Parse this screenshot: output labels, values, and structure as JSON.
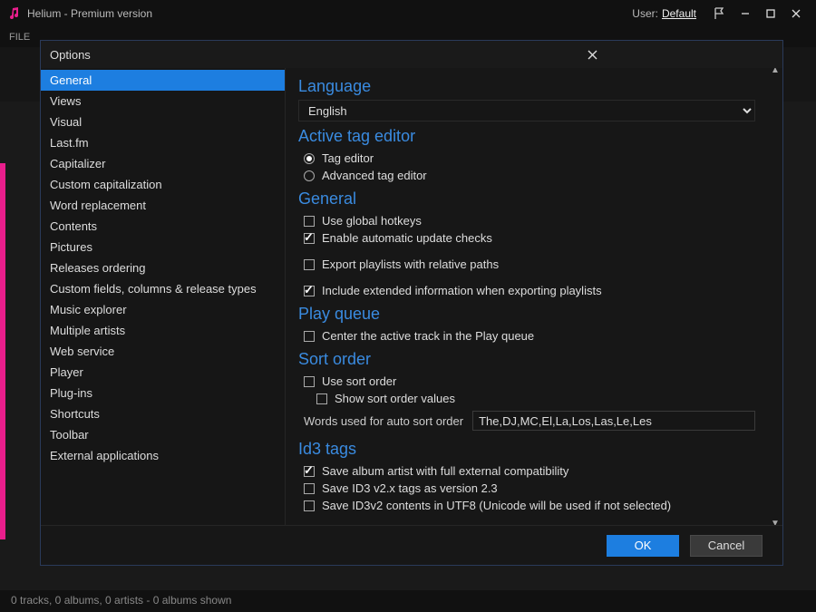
{
  "title_bar": {
    "app_title": "Helium - Premium version",
    "user_label": "User:",
    "user_name": "Default"
  },
  "menu_bar": {
    "file": "FILE"
  },
  "status_bar": "0 tracks, 0 albums, 0 artists - 0 albums shown",
  "dialog": {
    "title": "Options",
    "ok": "OK",
    "cancel": "Cancel"
  },
  "sidebar": {
    "items": [
      "General",
      "Views",
      "Visual",
      "Last.fm",
      "Capitalizer",
      "Custom capitalization",
      "Word replacement",
      "Contents",
      "Pictures",
      "Releases ordering",
      "Custom fields, columns & release types",
      "Music explorer",
      "Multiple artists",
      "Web service",
      "Player",
      "Plug-ins",
      "Shortcuts",
      "Toolbar",
      "External applications"
    ],
    "selected_index": 0
  },
  "content": {
    "language": {
      "title": "Language",
      "value": "English"
    },
    "active_tag_editor": {
      "title": "Active tag editor",
      "tag_editor": "Tag editor",
      "advanced_tag_editor": "Advanced tag editor",
      "selected": "tag_editor"
    },
    "general": {
      "title": "General",
      "use_global_hotkeys": {
        "label": "Use global hotkeys",
        "checked": false
      },
      "enable_updates": {
        "label": "Enable automatic update checks",
        "checked": true
      },
      "export_relative": {
        "label": "Export playlists with relative paths",
        "checked": false
      },
      "include_extended": {
        "label": "Include extended information when exporting playlists",
        "checked": true
      }
    },
    "play_queue": {
      "title": "Play queue",
      "center_active": {
        "label": "Center the active track in the Play queue",
        "checked": false
      }
    },
    "sort_order": {
      "title": "Sort order",
      "use_sort_order": {
        "label": "Use sort order",
        "checked": false
      },
      "show_values": {
        "label": "Show sort order values",
        "checked": false
      },
      "words_label": "Words used for auto sort order",
      "words_value": "The,DJ,MC,El,La,Los,Las,Le,Les"
    },
    "id3_tags": {
      "title": "Id3 tags",
      "save_album_artist": {
        "label": "Save album artist with full external compatibility",
        "checked": true
      },
      "save_v23": {
        "label": "Save ID3 v2.x tags as version 2.3",
        "checked": false
      },
      "save_utf8": {
        "label": "Save ID3v2 contents in UTF8 (Unicode will be used if not selected)",
        "checked": false
      }
    }
  }
}
